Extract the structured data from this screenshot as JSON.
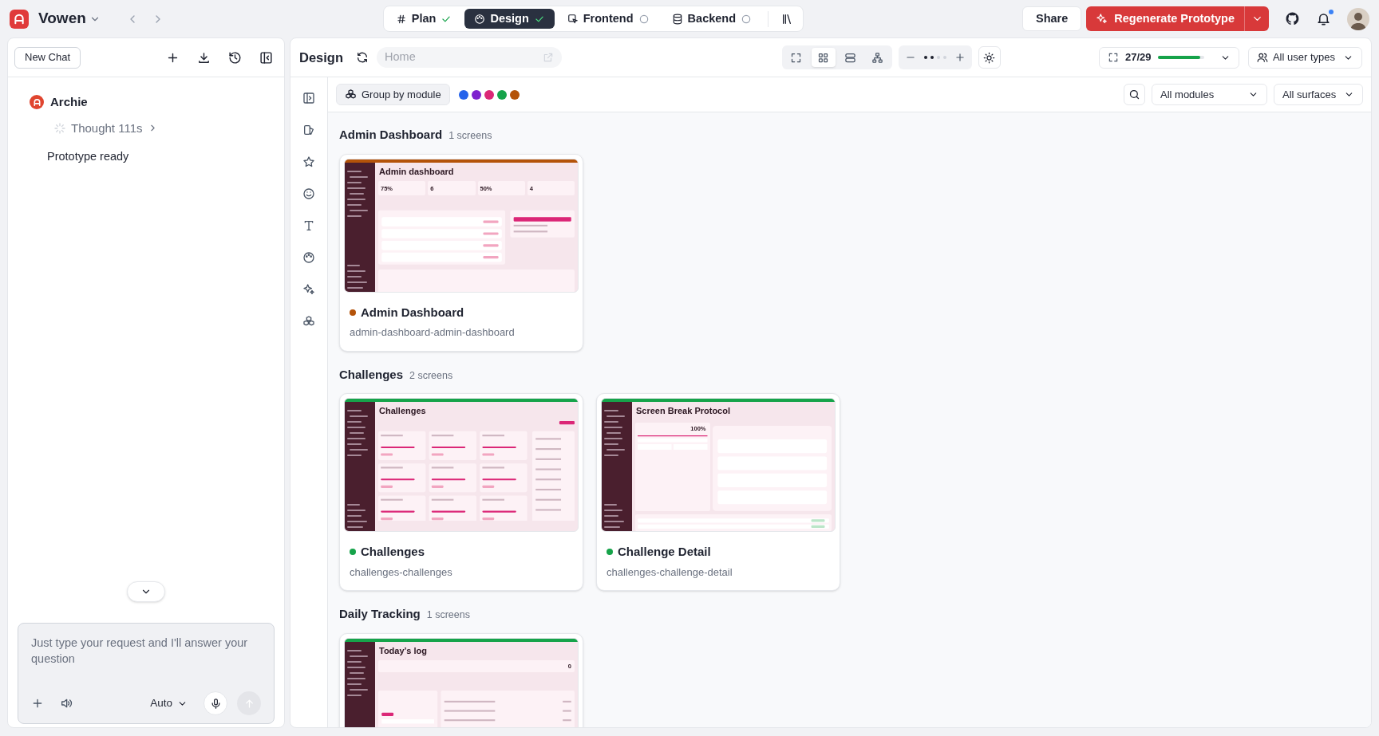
{
  "app": {
    "name": "Vowen"
  },
  "stages": [
    {
      "label": "Plan",
      "selected": false,
      "done": true
    },
    {
      "label": "Design",
      "selected": true,
      "done": true
    },
    {
      "label": "Frontend",
      "selected": false,
      "done": false
    },
    {
      "label": "Backend",
      "selected": false,
      "done": false
    }
  ],
  "actions": {
    "share": "Share",
    "regenerate": "Regenerate Prototype",
    "notification_unread": true
  },
  "chat": {
    "new_chat": "New Chat",
    "agent": "Archie",
    "thought": "Thought 111s",
    "message": "Prototype ready",
    "input_placeholder": "Just type your request and I'll answer your question",
    "mode": "Auto"
  },
  "design": {
    "title": "Design",
    "route_placeholder": "Home",
    "view_modes": [
      {
        "kind": "fullscreen",
        "selected": false
      },
      {
        "kind": "grid",
        "selected": true
      },
      {
        "kind": "list",
        "selected": false
      },
      {
        "kind": "tree",
        "selected": false
      }
    ],
    "zoom": {
      "level": 0.5
    },
    "progress": {
      "label": "27/29",
      "level": 0.93
    },
    "user_types": "All user types",
    "group_by": "Group by module",
    "module_colors": [
      {
        "color": "#2563eb"
      },
      {
        "color": "#7e22ce"
      },
      {
        "color": "#db2777"
      },
      {
        "color": "#16a34a"
      },
      {
        "color": "#b45309"
      }
    ],
    "filters": [
      "All modules",
      "All surfaces"
    ]
  },
  "groups": [
    {
      "name": "Admin Dashboard",
      "count": "1 screens",
      "screens": [
        {
          "title": "Admin Dashboard",
          "slug": "admin-dashboard-admin-dashboard",
          "color": "#b45309",
          "preview": {
            "kind": "dashboard",
            "heading": "Admin dashboard",
            "stats": [
              "75%",
              "6",
              "50%",
              "4"
            ]
          }
        }
      ]
    },
    {
      "name": "Challenges",
      "count": "2 screens",
      "screens": [
        {
          "title": "Challenges",
          "slug": "challenges-challenges",
          "color": "#16a34a",
          "preview": {
            "kind": "cards",
            "heading": "Challenges"
          }
        },
        {
          "title": "Challenge Detail",
          "slug": "challenges-challenge-detail",
          "color": "#16a34a",
          "preview": {
            "kind": "detail",
            "heading": "Screen Break Protocol",
            "stats": [
              "100%"
            ]
          }
        }
      ]
    },
    {
      "name": "Daily Tracking",
      "count": "1 screens",
      "screens": [
        {
          "color": "#16a34a",
          "preview": {
            "kind": "log",
            "heading": "Today’s log",
            "stats": [
              "0"
            ]
          }
        }
      ]
    }
  ]
}
